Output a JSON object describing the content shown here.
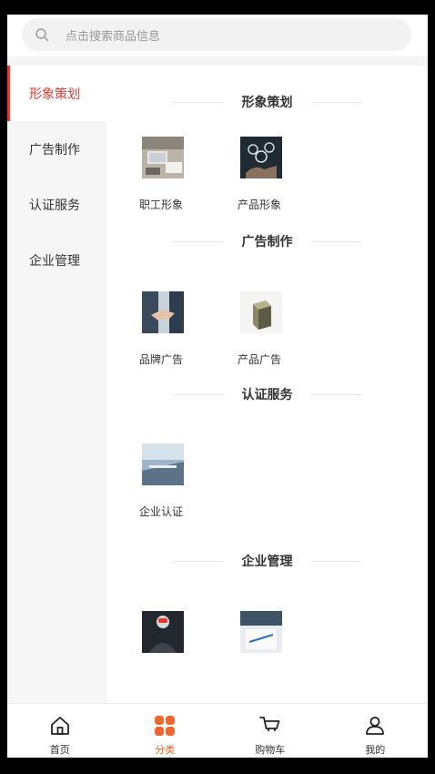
{
  "search": {
    "placeholder": "点击搜索商品信息"
  },
  "sidebar": {
    "items": [
      {
        "label": "形象策划",
        "active": true
      },
      {
        "label": "广告制作",
        "active": false
      },
      {
        "label": "认证服务",
        "active": false
      },
      {
        "label": "企业管理",
        "active": false
      }
    ]
  },
  "sections": [
    {
      "title": "形象策划",
      "items": [
        {
          "label": "职工形象",
          "image": "office-desk-photo"
        },
        {
          "label": "产品形象",
          "image": "hands-icons-photo"
        }
      ]
    },
    {
      "title": "广告制作",
      "items": [
        {
          "label": "品牌广告",
          "image": "handshake-photo"
        },
        {
          "label": "产品广告",
          "image": "product-box-photo"
        }
      ]
    },
    {
      "title": "认证服务",
      "items": [
        {
          "label": "企业认证",
          "image": "keyboard-photo"
        }
      ]
    },
    {
      "title": "企业管理",
      "items": [
        {
          "image": "business-person-photo"
        },
        {
          "image": "documents-pen-photo"
        }
      ]
    }
  ],
  "tabbar": {
    "tabs": [
      {
        "label": "首页",
        "icon": "home-icon"
      },
      {
        "label": "分类",
        "icon": "category-grid-icon",
        "active": true
      },
      {
        "label": "购物车",
        "icon": "cart-icon"
      },
      {
        "label": "我的",
        "icon": "user-icon"
      }
    ]
  },
  "colors": {
    "accent": "#e53935",
    "tab_active": "#f0662c",
    "sidebar_bg": "#f6f6f6"
  }
}
